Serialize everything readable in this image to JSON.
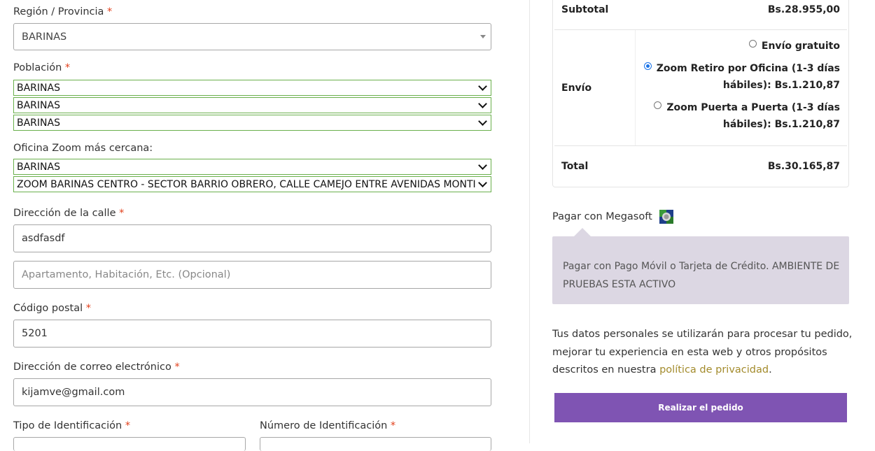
{
  "billing": {
    "region_label": "Región / Provincia",
    "region_value": "BARINAS",
    "poblacion_label": "Población",
    "poblacion_selects": [
      "BARINAS",
      "BARINAS",
      "BARINAS"
    ],
    "oficina_label": "Oficina Zoom más cercana:",
    "oficina_selects": [
      "BARINAS",
      "ZOOM BARINAS CENTRO - SECTOR BARRIO OBRERO, CALLE CAMEJO ENTRE AVENIDAS MONTILLA"
    ],
    "street_label": "Dirección de la calle",
    "street_value": "asdfasdf",
    "street2_placeholder": "Apartamento, Habitación, Etc. (Opcional)",
    "postal_label": "Código postal",
    "postal_value": "5201",
    "email_label": "Dirección de correo electrónico",
    "email_value": "kijamve@gmail.com",
    "id_type_label": "Tipo de Identificación",
    "id_number_label": "Número de Identificación",
    "required_mark": "*"
  },
  "order": {
    "subtotal_label": "Subtotal",
    "subtotal_value": "Bs.28.955,00",
    "envio_label": "Envío",
    "shipping_options": [
      {
        "line1": "Envío gratuito",
        "line2": "",
        "selected": false
      },
      {
        "line1": "Zoom Retiro por Oficina (1-3 días",
        "line2": "hábiles): Bs.1.210,87",
        "selected": true
      },
      {
        "line1": "Zoom Puerta a Puerta (1-3 días",
        "line2": "hábiles): Bs.1.210,87",
        "selected": false
      }
    ],
    "total_label": "Total",
    "total_value": "Bs.30.165,87"
  },
  "payment": {
    "method_label": "Pagar con Megasoft",
    "description": "Pagar con Pago Móvil o Tarjeta de Crédito. AMBIENTE DE PRUEBAS ESTA ACTIVO"
  },
  "privacy": {
    "text": "Tus datos personales se utilizarán para procesar tu pedido, mejorar tu experiencia en esta web y otros propósitos descritos en nuestra",
    "link": "política de privacidad",
    "end": "."
  },
  "place_order_label": "Realizar el pedido",
  "colors": {
    "accent": "#7f54b3",
    "required": "#e2401c",
    "link": "#a38b2c",
    "valid_border": "#6ab04c",
    "desc_bg": "#dcd7e3"
  }
}
